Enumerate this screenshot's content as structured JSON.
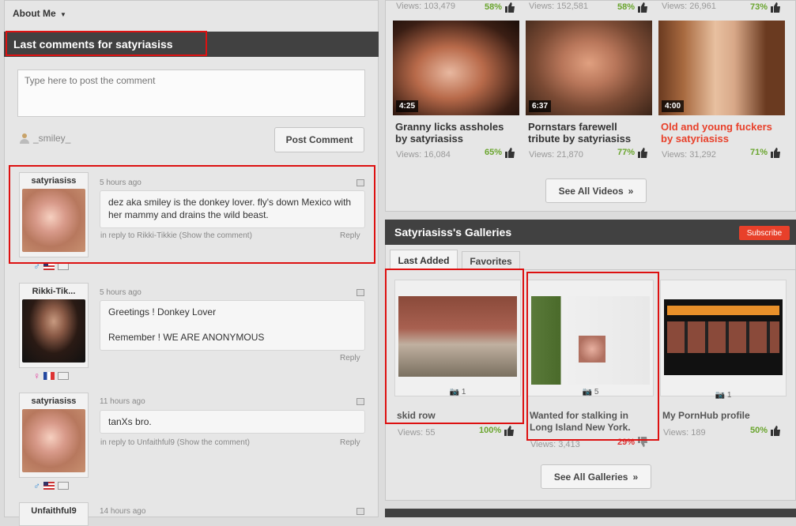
{
  "nav": {
    "about_me": "About Me"
  },
  "comments_panel": {
    "title": "Last comments for satyriasiss",
    "textarea_placeholder": "Type here to post the comment",
    "current_user": "_smiley_",
    "post_button": "Post Comment",
    "comments": [
      {
        "author": "satyriasiss",
        "time": "5 hours ago",
        "text": "dez aka smiley is the donkey lover. fly's down Mexico with her mammy and drains the wild beast.",
        "reply_to": "in reply to Rikki-Tikkie (Show the comment)",
        "reply_label": "Reply"
      },
      {
        "author": "Rikki-Tik...",
        "time": "5 hours ago",
        "text_line1": "Greetings ! Donkey Lover",
        "text_line2": "Remember ! WE ARE ANONYMOUS",
        "reply_label": "Reply"
      },
      {
        "author": "satyriasiss",
        "time": "11 hours ago",
        "text": "tanXs bro.",
        "reply_to": "in reply to Unfaithful9 (Show the comment)",
        "reply_label": "Reply"
      },
      {
        "author": "Unfaithful9",
        "time": "14 hours ago"
      }
    ]
  },
  "top_stats": [
    {
      "views": "Views: 103,479",
      "rating": "58%"
    },
    {
      "views": "Views: 152,581",
      "rating": "58%"
    },
    {
      "views": "Views: 26,961",
      "rating": "73%"
    }
  ],
  "videos": [
    {
      "duration": "4:25",
      "title": "Granny licks assholes by satyriasiss",
      "views": "Views: 16,084",
      "rating": "65%"
    },
    {
      "duration": "6:37",
      "title": "Pornstars farewell tribute by satyriasiss",
      "views": "Views: 21,870",
      "rating": "77%"
    },
    {
      "duration": "4:00",
      "title": "Old and young fuckers by satyriasiss",
      "views": "Views: 31,292",
      "rating": "71%"
    }
  ],
  "see_all_videos": "See All Videos",
  "galleries": {
    "title": "Satyriasiss's Galleries",
    "subscribe": "Subscribe",
    "tabs": [
      "Last Added",
      "Favorites"
    ],
    "items": [
      {
        "count": "1",
        "title": "skid row",
        "views": "Views: 55",
        "rating": "100%"
      },
      {
        "count": "5",
        "title": "Wanted for stalking in Long Island New York.",
        "views": "Views: 3,413",
        "rating": "29%"
      },
      {
        "count": "1",
        "title": "My PornHub profile",
        "views": "Views: 189",
        "rating": "50%"
      }
    ],
    "see_all": "See All Galleries"
  },
  "colors": {
    "accent_red": "#d11",
    "green": "#6aa52e",
    "header_bg": "#414141",
    "subscribe_bg": "#e8402a"
  }
}
